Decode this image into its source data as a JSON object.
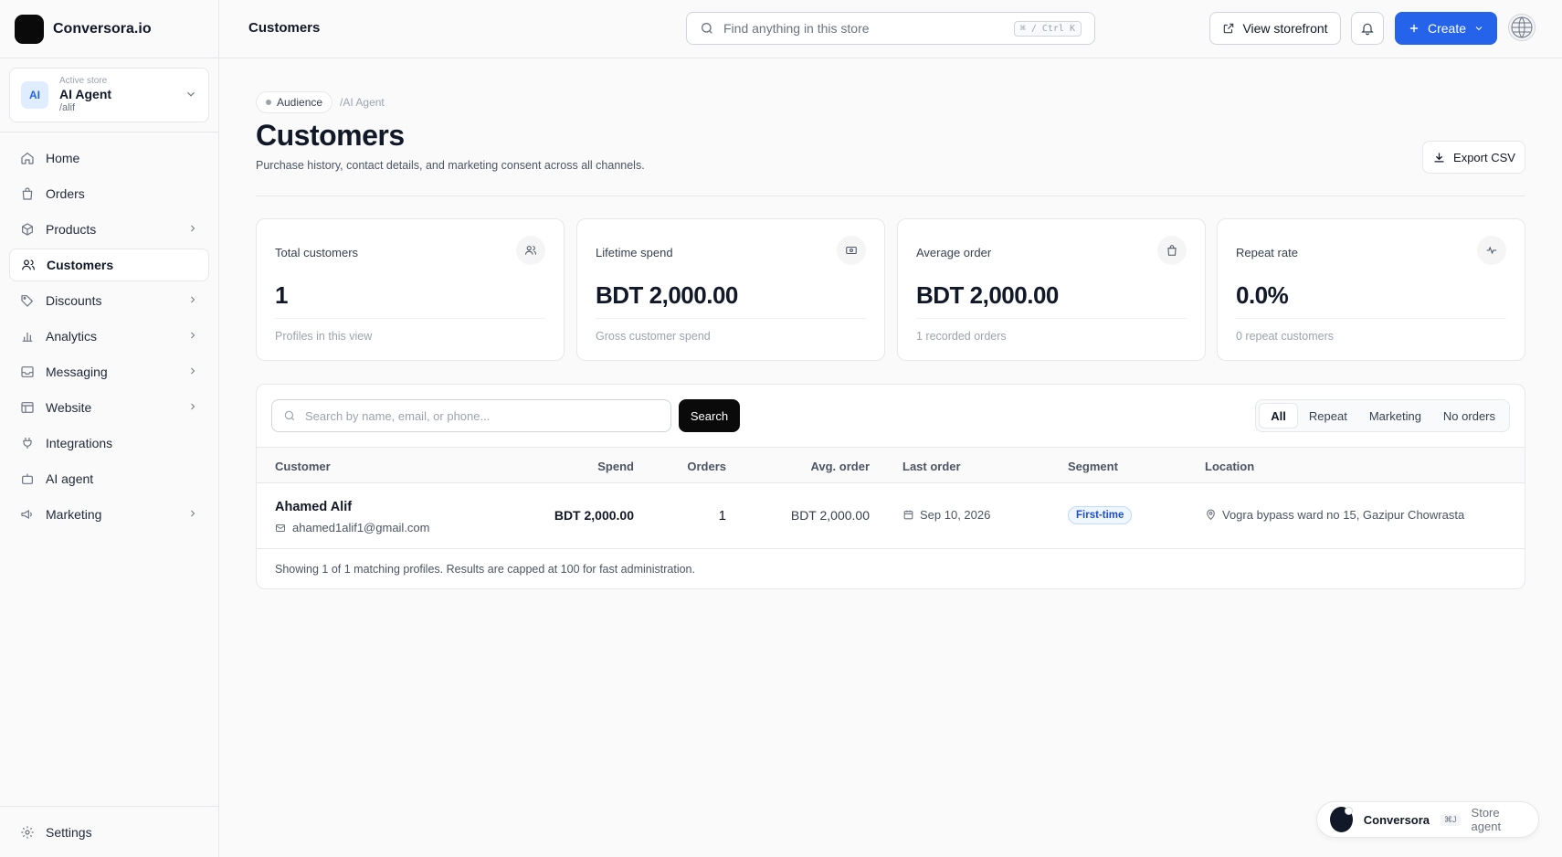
{
  "app": {
    "name": "Conversora.io"
  },
  "store": {
    "caption": "Active store",
    "avatar": "AI",
    "name": "AI Agent",
    "handle": "/alif"
  },
  "sidebar": {
    "items": [
      {
        "label": "Home",
        "icon": "home-icon",
        "chevron": false,
        "active": false
      },
      {
        "label": "Orders",
        "icon": "shopping-bag-icon",
        "chevron": false,
        "active": false
      },
      {
        "label": "Products",
        "icon": "package-icon",
        "chevron": true,
        "active": false
      },
      {
        "label": "Customers",
        "icon": "users-icon",
        "chevron": false,
        "active": true
      },
      {
        "label": "Discounts",
        "icon": "tag-icon",
        "chevron": true,
        "active": false
      },
      {
        "label": "Analytics",
        "icon": "bar-chart-icon",
        "chevron": true,
        "active": false
      },
      {
        "label": "Messaging",
        "icon": "inbox-icon",
        "chevron": true,
        "active": false
      },
      {
        "label": "Website",
        "icon": "layout-icon",
        "chevron": true,
        "active": false
      },
      {
        "label": "Integrations",
        "icon": "plug-icon",
        "chevron": false,
        "active": false
      },
      {
        "label": "AI agent",
        "icon": "bot-icon",
        "chevron": false,
        "active": false
      },
      {
        "label": "Marketing",
        "icon": "megaphone-icon",
        "chevron": true,
        "active": false
      }
    ],
    "settings_label": "Settings"
  },
  "topbar": {
    "title": "Customers",
    "search_placeholder": "Find anything in this store",
    "search_shortcut": "⌘ / Ctrl K",
    "storefront_label": "View storefront",
    "create_label": "Create"
  },
  "page": {
    "breadcrumb_tag": "Audience",
    "breadcrumb_path": "/AI Agent",
    "title": "Customers",
    "subtitle": "Purchase history, contact details, and marketing consent across all channels.",
    "export_label": "Export CSV"
  },
  "stats": [
    {
      "label": "Total customers",
      "value": "1",
      "note": "Profiles in this view",
      "icon": "users-icon"
    },
    {
      "label": "Lifetime spend",
      "value": "BDT 2,000.00",
      "note": "Gross customer spend",
      "icon": "banknote-icon"
    },
    {
      "label": "Average order",
      "value": "BDT 2,000.00",
      "note": "1 recorded orders",
      "icon": "shopping-bag-icon"
    },
    {
      "label": "Repeat rate",
      "value": "0.0%",
      "note": "0 repeat customers",
      "icon": "activity-icon"
    }
  ],
  "table": {
    "search_placeholder": "Search by name, email, or phone...",
    "search_button": "Search",
    "filters": [
      "All",
      "Repeat",
      "Marketing",
      "No orders"
    ],
    "active_filter": "All",
    "columns": [
      "Customer",
      "Spend",
      "Orders",
      "Avg. order",
      "Last order",
      "Segment",
      "Location"
    ],
    "rows": [
      {
        "name": "Ahamed Alif",
        "email": "ahamed1alif1@gmail.com",
        "spend": "BDT 2,000.00",
        "orders": "1",
        "avg_order": "BDT 2,000.00",
        "last_order": "Sep 10, 2026",
        "segment": "First-time",
        "location": "Vogra bypass ward no 15, Gazipur Chowrasta"
      }
    ],
    "footer": "Showing 1 of 1 matching profiles. Results are capped at 100 for fast administration."
  },
  "agent_widget": {
    "name": "Conversora",
    "shortcut": "⌘J",
    "label": "Store agent"
  },
  "colors": {
    "accent": "#2563eb",
    "primary_dark": "#0a0a0a",
    "badge_blue": "#1d4ed8"
  }
}
